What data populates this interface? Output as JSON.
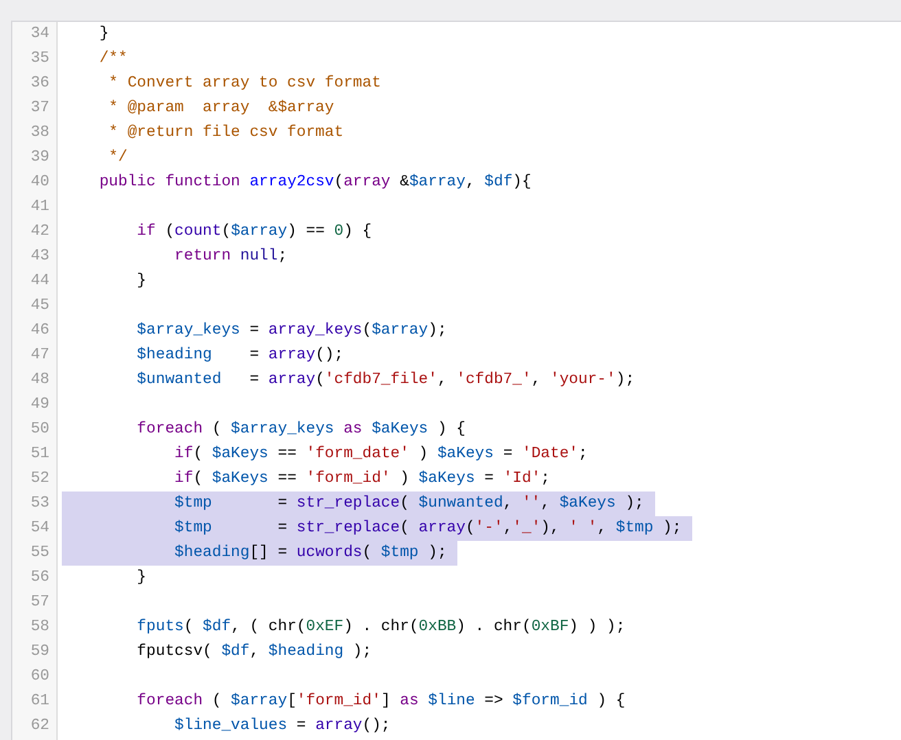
{
  "editor": {
    "lines": [
      {
        "number": "34",
        "selected": false,
        "tokens": [
          {
            "kind": "plain",
            "text": "    }"
          }
        ]
      },
      {
        "number": "35",
        "selected": false,
        "tokens": [
          {
            "kind": "comment",
            "text": "    /**"
          }
        ]
      },
      {
        "number": "36",
        "selected": false,
        "tokens": [
          {
            "kind": "comment",
            "text": "     * Convert array to csv format"
          }
        ]
      },
      {
        "number": "37",
        "selected": false,
        "tokens": [
          {
            "kind": "comment",
            "text": "     * @param  array  &$array"
          }
        ]
      },
      {
        "number": "38",
        "selected": false,
        "tokens": [
          {
            "kind": "comment",
            "text": "     * @return file csv format"
          }
        ]
      },
      {
        "number": "39",
        "selected": false,
        "tokens": [
          {
            "kind": "comment",
            "text": "     */"
          }
        ]
      },
      {
        "number": "40",
        "selected": false,
        "tokens": [
          {
            "kind": "keyword",
            "text": "    public"
          },
          {
            "kind": "keyword",
            "text": " function"
          },
          {
            "kind": "def",
            "text": " array2csv"
          },
          {
            "kind": "plain",
            "text": "("
          },
          {
            "kind": "keyword",
            "text": "array"
          },
          {
            "kind": "plain",
            "text": " &"
          },
          {
            "kind": "variable",
            "text": "$array"
          },
          {
            "kind": "plain",
            "text": ","
          },
          {
            "kind": "variable",
            "text": " $df"
          },
          {
            "kind": "plain",
            "text": "){"
          }
        ]
      },
      {
        "number": "41",
        "selected": false
      },
      {
        "number": "42",
        "selected": false,
        "tokens": [
          {
            "kind": "keyword",
            "text": "        if"
          },
          {
            "kind": "plain",
            "text": " ("
          },
          {
            "kind": "builtin",
            "text": "count"
          },
          {
            "kind": "plain",
            "text": "("
          },
          {
            "kind": "variable",
            "text": "$array"
          },
          {
            "kind": "plain",
            "text": ") =="
          },
          {
            "kind": "number",
            "text": " 0"
          },
          {
            "kind": "plain",
            "text": ") {"
          }
        ]
      },
      {
        "number": "43",
        "selected": false,
        "tokens": [
          {
            "kind": "keyword",
            "text": "            return"
          },
          {
            "kind": "atom",
            "text": " null"
          },
          {
            "kind": "plain",
            "text": ";"
          }
        ]
      },
      {
        "number": "44",
        "selected": false,
        "tokens": [
          {
            "kind": "plain",
            "text": "        }"
          }
        ]
      },
      {
        "number": "45",
        "selected": false
      },
      {
        "number": "46",
        "selected": false,
        "tokens": [
          {
            "kind": "variable",
            "text": "        $array_keys"
          },
          {
            "kind": "plain",
            "text": " ="
          },
          {
            "kind": "builtin",
            "text": " array_keys"
          },
          {
            "kind": "plain",
            "text": "("
          },
          {
            "kind": "variable",
            "text": "$array"
          },
          {
            "kind": "plain",
            "text": ");"
          }
        ]
      },
      {
        "number": "47",
        "selected": false,
        "tokens": [
          {
            "kind": "variable",
            "text": "        $heading"
          },
          {
            "kind": "plain",
            "text": "    ="
          },
          {
            "kind": "builtin",
            "text": " array"
          },
          {
            "kind": "plain",
            "text": "();"
          }
        ]
      },
      {
        "number": "48",
        "selected": false,
        "tokens": [
          {
            "kind": "variable",
            "text": "        $unwanted"
          },
          {
            "kind": "plain",
            "text": "   ="
          },
          {
            "kind": "builtin",
            "text": " array"
          },
          {
            "kind": "plain",
            "text": "("
          },
          {
            "kind": "string",
            "text": "'cfdb7_file'"
          },
          {
            "kind": "plain",
            "text": ","
          },
          {
            "kind": "string",
            "text": " 'cfdb7_'"
          },
          {
            "kind": "plain",
            "text": ","
          },
          {
            "kind": "string",
            "text": " 'your-'"
          },
          {
            "kind": "plain",
            "text": ");"
          }
        ]
      },
      {
        "number": "49",
        "selected": false
      },
      {
        "number": "50",
        "selected": false,
        "tokens": [
          {
            "kind": "keyword",
            "text": "        foreach"
          },
          {
            "kind": "plain",
            "text": " ("
          },
          {
            "kind": "variable",
            "text": " $array_keys"
          },
          {
            "kind": "keyword",
            "text": " as"
          },
          {
            "kind": "variable",
            "text": " $aKeys"
          },
          {
            "kind": "plain",
            "text": " ) {"
          }
        ]
      },
      {
        "number": "51",
        "selected": false,
        "tokens": [
          {
            "kind": "keyword",
            "text": "            if"
          },
          {
            "kind": "plain",
            "text": "("
          },
          {
            "kind": "variable",
            "text": " $aKeys"
          },
          {
            "kind": "plain",
            "text": " =="
          },
          {
            "kind": "string",
            "text": " 'form_date'"
          },
          {
            "kind": "plain",
            "text": " )"
          },
          {
            "kind": "variable",
            "text": " $aKeys"
          },
          {
            "kind": "plain",
            "text": " ="
          },
          {
            "kind": "string",
            "text": " 'Date'"
          },
          {
            "kind": "plain",
            "text": ";"
          }
        ]
      },
      {
        "number": "52",
        "selected": false,
        "tokens": [
          {
            "kind": "keyword",
            "text": "            if"
          },
          {
            "kind": "plain",
            "text": "("
          },
          {
            "kind": "variable",
            "text": " $aKeys"
          },
          {
            "kind": "plain",
            "text": " =="
          },
          {
            "kind": "string",
            "text": " 'form_id'"
          },
          {
            "kind": "plain",
            "text": " )"
          },
          {
            "kind": "variable",
            "text": " $aKeys"
          },
          {
            "kind": "plain",
            "text": " ="
          },
          {
            "kind": "string",
            "text": " 'Id'"
          },
          {
            "kind": "plain",
            "text": ";"
          }
        ]
      },
      {
        "number": "53",
        "selected": true,
        "tokens": [
          {
            "kind": "variable",
            "text": "            $tmp"
          },
          {
            "kind": "plain",
            "text": "       ="
          },
          {
            "kind": "builtin",
            "text": " str_replace"
          },
          {
            "kind": "plain",
            "text": "("
          },
          {
            "kind": "variable",
            "text": " $unwanted"
          },
          {
            "kind": "plain",
            "text": ","
          },
          {
            "kind": "string",
            "text": " ''"
          },
          {
            "kind": "plain",
            "text": ","
          },
          {
            "kind": "variable",
            "text": " $aKeys"
          },
          {
            "kind": "plain",
            "text": " );"
          }
        ]
      },
      {
        "number": "54",
        "selected": true,
        "tokens": [
          {
            "kind": "variable",
            "text": "            $tmp"
          },
          {
            "kind": "plain",
            "text": "       ="
          },
          {
            "kind": "builtin",
            "text": " str_replace"
          },
          {
            "kind": "plain",
            "text": "("
          },
          {
            "kind": "builtin",
            "text": " array"
          },
          {
            "kind": "plain",
            "text": "("
          },
          {
            "kind": "string",
            "text": "'-'"
          },
          {
            "kind": "plain",
            "text": ","
          },
          {
            "kind": "string",
            "text": "'_'"
          },
          {
            "kind": "plain",
            "text": "),"
          },
          {
            "kind": "string",
            "text": " ' '"
          },
          {
            "kind": "plain",
            "text": ","
          },
          {
            "kind": "variable",
            "text": " $tmp"
          },
          {
            "kind": "plain",
            "text": " );"
          }
        ]
      },
      {
        "number": "55",
        "selected": true,
        "tokens": [
          {
            "kind": "variable",
            "text": "            $heading"
          },
          {
            "kind": "plain",
            "text": "[] ="
          },
          {
            "kind": "builtin",
            "text": " ucwords"
          },
          {
            "kind": "plain",
            "text": "("
          },
          {
            "kind": "variable",
            "text": " $tmp"
          },
          {
            "kind": "plain",
            "text": " );"
          }
        ]
      },
      {
        "number": "56",
        "selected": false,
        "tokens": [
          {
            "kind": "plain",
            "text": "        }"
          }
        ]
      },
      {
        "number": "57",
        "selected": false
      },
      {
        "number": "58",
        "selected": false,
        "tokens": [
          {
            "kind": "function",
            "text": "        fputs"
          },
          {
            "kind": "plain",
            "text": "("
          },
          {
            "kind": "variable",
            "text": " $df"
          },
          {
            "kind": "plain",
            "text": ", ( chr("
          },
          {
            "kind": "number",
            "text": "0xEF"
          },
          {
            "kind": "plain",
            "text": ") . chr("
          },
          {
            "kind": "number",
            "text": "0xBB"
          },
          {
            "kind": "plain",
            "text": ") . chr("
          },
          {
            "kind": "number",
            "text": "0xBF"
          },
          {
            "kind": "plain",
            "text": ") ) );"
          }
        ]
      },
      {
        "number": "59",
        "selected": false,
        "tokens": [
          {
            "kind": "plain",
            "text": "        fputcsv("
          },
          {
            "kind": "variable",
            "text": " $df"
          },
          {
            "kind": "plain",
            "text": ","
          },
          {
            "kind": "variable",
            "text": " $heading"
          },
          {
            "kind": "plain",
            "text": " );"
          }
        ]
      },
      {
        "number": "60",
        "selected": false
      },
      {
        "number": "61",
        "selected": false,
        "tokens": [
          {
            "kind": "keyword",
            "text": "        foreach"
          },
          {
            "kind": "plain",
            "text": " ("
          },
          {
            "kind": "variable",
            "text": " $array"
          },
          {
            "kind": "plain",
            "text": "["
          },
          {
            "kind": "string",
            "text": "'form_id'"
          },
          {
            "kind": "plain",
            "text": "]"
          },
          {
            "kind": "keyword",
            "text": " as"
          },
          {
            "kind": "variable",
            "text": " $line"
          },
          {
            "kind": "plain",
            "text": " =>"
          },
          {
            "kind": "variable",
            "text": " $form_id"
          },
          {
            "kind": "plain",
            "text": " ) {"
          }
        ]
      },
      {
        "number": "62",
        "selected": false,
        "tokens": [
          {
            "kind": "variable",
            "text": "            $line_values"
          },
          {
            "kind": "plain",
            "text": " ="
          },
          {
            "kind": "builtin",
            "text": " array"
          },
          {
            "kind": "plain",
            "text": "();"
          }
        ]
      }
    ]
  }
}
